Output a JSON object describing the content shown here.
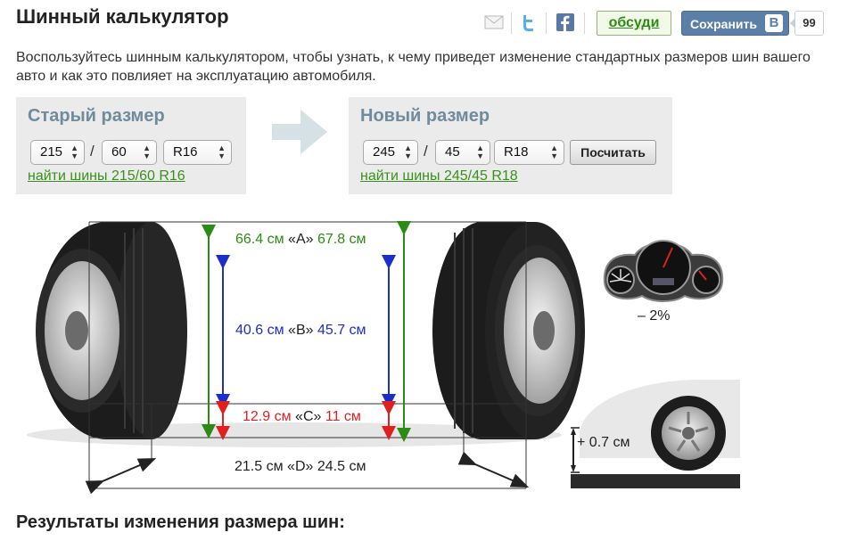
{
  "page": {
    "title": "Шинный калькулятор",
    "intro": "Воспользуйтесь шинным калькулятором, чтобы узнать, к чему приведет изменение стандартных размеров шин вашего авто и как это повлияет на эксплуатацию автомобиля.",
    "results_heading": "Результаты изменения размера шин:"
  },
  "share": {
    "icons": [
      "mail-icon",
      "twitter-icon",
      "facebook-icon"
    ],
    "discuss_label": "обсуди",
    "vk_save_label": "Сохранить",
    "vk_logo": "В",
    "vk_count": "99"
  },
  "old_size": {
    "heading": "Старый размер",
    "width": "215",
    "profile": "60",
    "rim": "R16",
    "separator": "/",
    "link": "найти шины 215/60 R16"
  },
  "new_size": {
    "heading": "Новый размер",
    "width": "245",
    "profile": "45",
    "rim": "R18",
    "separator": "/",
    "link": "найти шины 245/45 R18",
    "calc_button": "Посчитать"
  },
  "diagram": {
    "A": {
      "old": "66.4 см",
      "label": "«A»",
      "new": "67.8 см"
    },
    "B": {
      "old": "40.6 см",
      "label": "«B»",
      "new": "45.7 см"
    },
    "C": {
      "old": "12.9 см",
      "label": "«C»",
      "new": "11 см"
    },
    "D": {
      "old": "21.5 см",
      "label": "«D»",
      "new": "24.5 см"
    }
  },
  "speedometer": {
    "change": "– 2%"
  },
  "clearance": {
    "change": "+ 0.7 см"
  },
  "colors": {
    "green": "#2c8b14",
    "blue": "#1b2ec8",
    "red": "#e01f1f",
    "link": "#37921d",
    "panel_title": "#6f8b9c"
  }
}
